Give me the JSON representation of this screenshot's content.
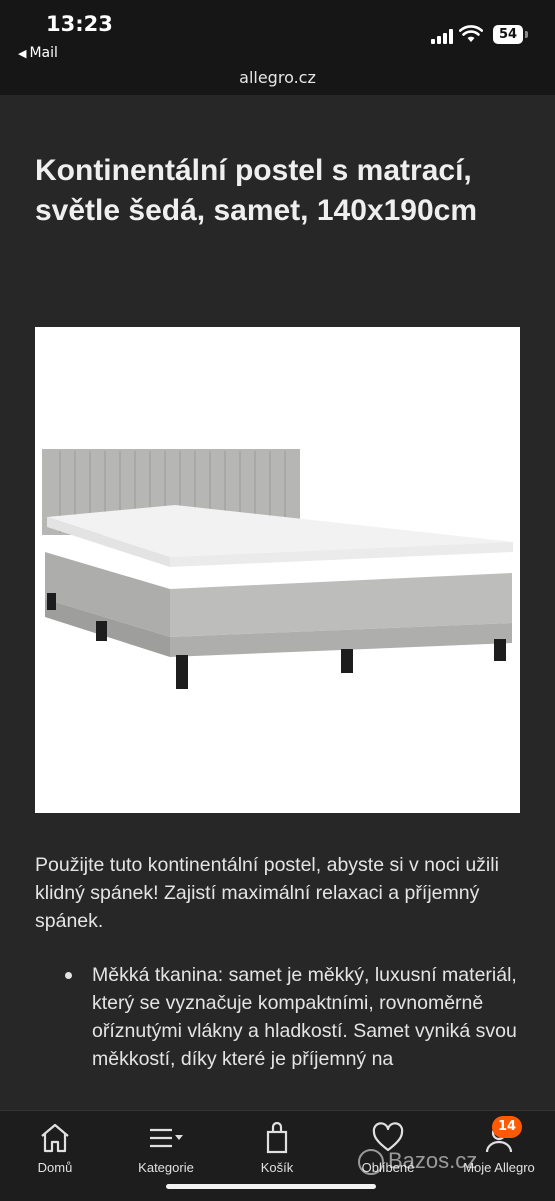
{
  "status_bar": {
    "time": "13:23",
    "back_label": "Mail",
    "battery": "54"
  },
  "browser": {
    "url": "allegro.cz"
  },
  "product": {
    "title": "Kontinentální postel s matrací, světle šedá, samet, 140x190cm",
    "description": "Použijte tuto kontinentální postel, abyste si v noci užili klidný spánek! Zajistí maximální relaxaci a příjemný spánek.",
    "bullets": [
      "Měkká tkanina: samet je měkký, luxusní materiál, který se vyznačuje kompaktními, rovnoměrně oříznutými vlákny a hladkostí. Samet vyniká svou měkkostí, díky které je příjemný na"
    ]
  },
  "tab_bar": {
    "tabs": [
      {
        "label": "Domů",
        "icon": "home-icon"
      },
      {
        "label": "Kategorie",
        "icon": "menu-icon"
      },
      {
        "label": "Košík",
        "icon": "cart-icon"
      },
      {
        "label": "Oblíbené",
        "icon": "heart-icon"
      },
      {
        "label": "Moje Allegro",
        "icon": "user-icon"
      }
    ],
    "badge_count": "14"
  },
  "watermark": {
    "text": "Bazos.cz"
  },
  "colors": {
    "background": "#272727",
    "bars": "#161616",
    "accent": "#ff5a00"
  }
}
